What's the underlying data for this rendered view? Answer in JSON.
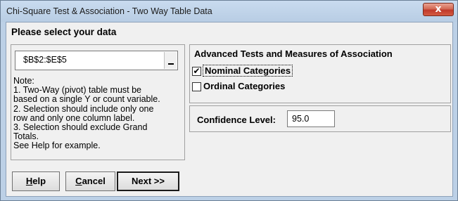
{
  "window": {
    "title": "Chi-Square Test & Association - Two Way Table Data",
    "close_glyph": "x"
  },
  "heading": "Please select your data",
  "range": {
    "value": "$B$2:$E$5"
  },
  "note": "Note:\n 1. Two-Way (pivot) table must be\n based on a single Y or count variable.\n 2. Selection should include only one\n row and only one column label.\n 3. Selection should exclude Grand\n Totals.\n See Help for example.",
  "advanced": {
    "title": "Advanced Tests and Measures of Association",
    "options": [
      {
        "label": "Nominal Categories",
        "checked": true
      },
      {
        "label": "Ordinal Categories",
        "checked": false
      }
    ]
  },
  "confidence": {
    "label": "Confidence Level:",
    "value": "95.0"
  },
  "buttons": {
    "help_first": "H",
    "help_rest": "elp",
    "cancel_first": "C",
    "cancel_rest": "ancel",
    "next": "Next >>"
  }
}
